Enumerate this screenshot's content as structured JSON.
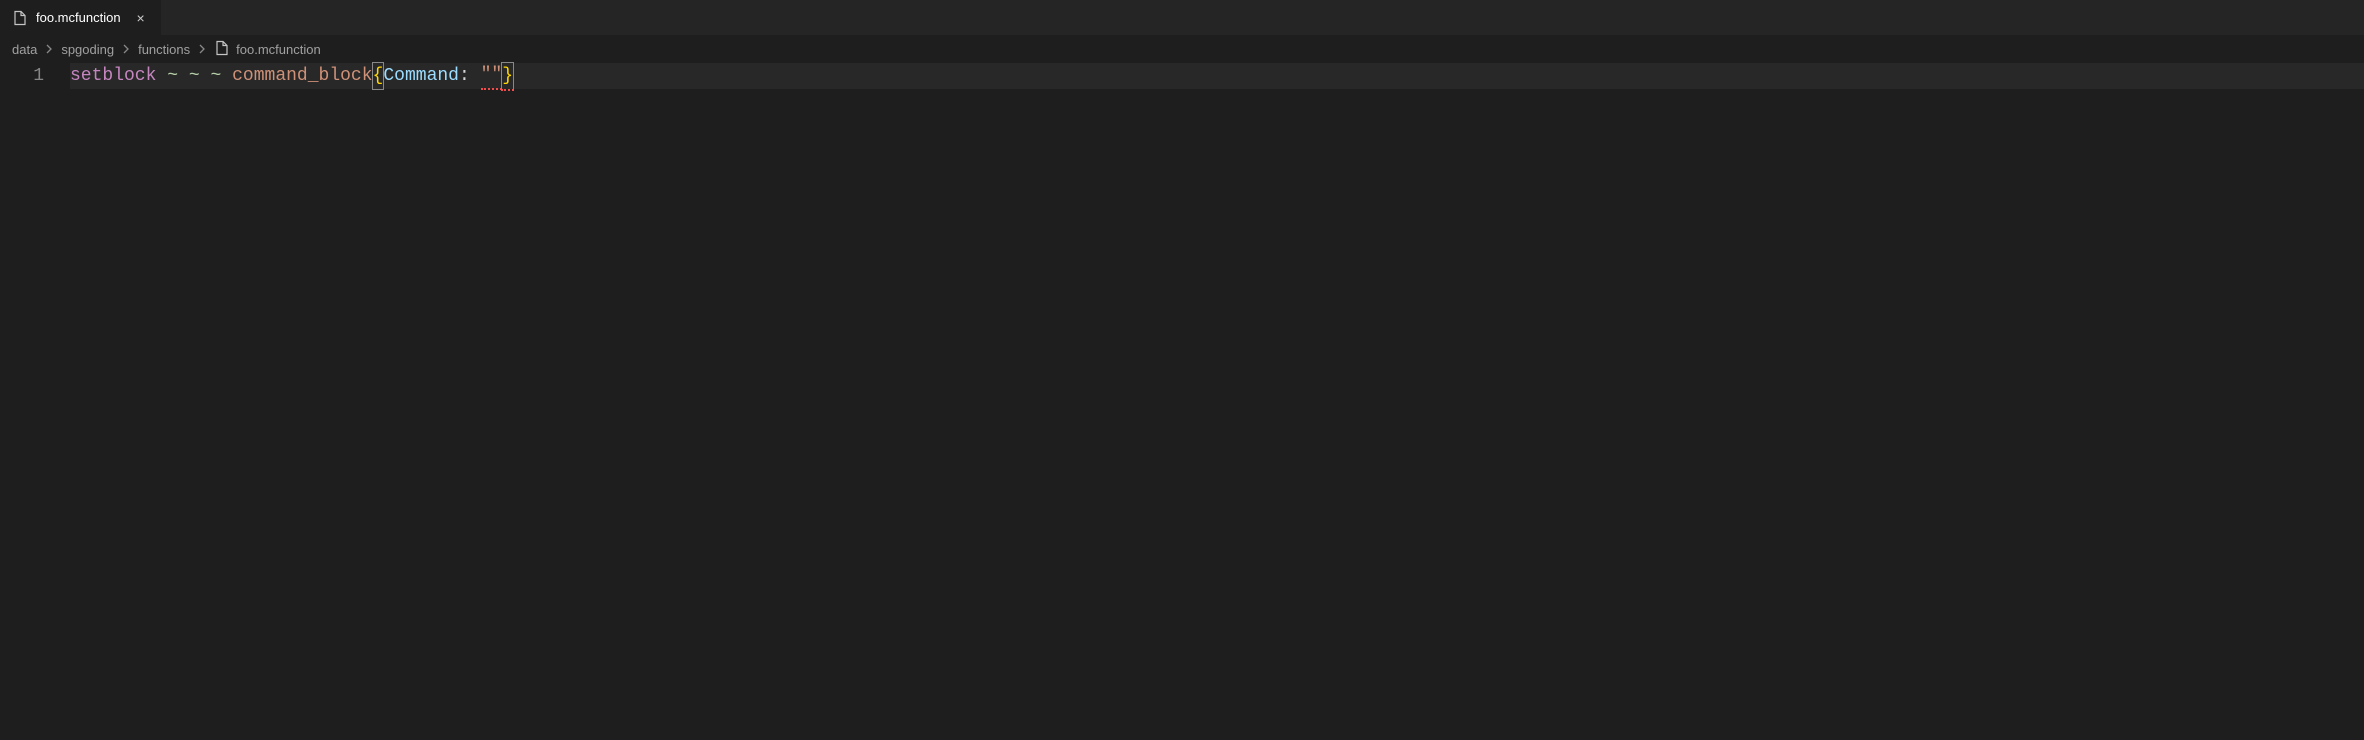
{
  "tab": {
    "label": "foo.mcfunction",
    "close_glyph": "×"
  },
  "breadcrumb": {
    "items": [
      "data",
      "spgoding",
      "functions"
    ],
    "file": "foo.mcfunction"
  },
  "editor": {
    "line_number": "1",
    "tokens": {
      "command": "setblock",
      "coord1": "~",
      "coord2": "~",
      "coord3": "~",
      "block": "command_block",
      "brace_open": "{",
      "key": "Command",
      "colon": ":",
      "string": "\"\"",
      "brace_close": "}"
    }
  }
}
